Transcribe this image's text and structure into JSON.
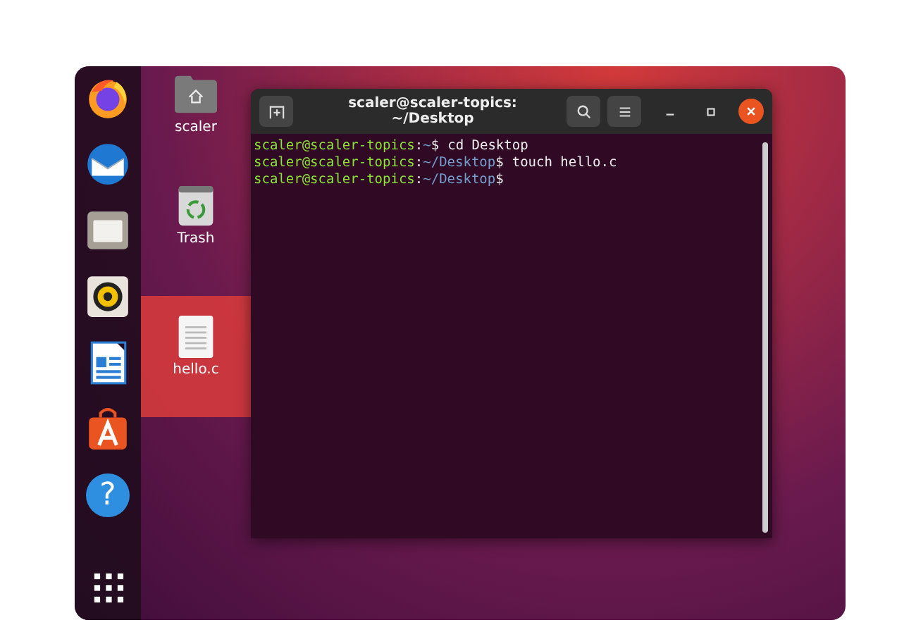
{
  "dock": {
    "items": [
      {
        "kind": "browser"
      },
      {
        "kind": "mail"
      },
      {
        "kind": "files"
      },
      {
        "kind": "speaker"
      },
      {
        "kind": "document"
      },
      {
        "kind": "store"
      },
      {
        "kind": "help",
        "glyph": "?"
      }
    ],
    "apps_button": {
      "kind": "grid"
    }
  },
  "desktop_icons": [
    {
      "kind": "home",
      "label": "scaler",
      "selected": false
    },
    {
      "kind": "trash",
      "label": "Trash",
      "selected": false
    },
    {
      "kind": "file",
      "label": "hello.c",
      "selected": true
    }
  ],
  "terminal": {
    "title": "scaler@scaler-topics: ~/Desktop",
    "lines": [
      {
        "user": "scaler@scaler-topics",
        "sep": ":",
        "path": "~",
        "prompt": "$",
        "command": "cd Desktop"
      },
      {
        "user": "scaler@scaler-topics",
        "sep": ":",
        "path": "~/Desktop",
        "prompt": "$",
        "command": "touch hello.c"
      },
      {
        "user": "scaler@scaler-topics",
        "sep": ":",
        "path": "~/Desktop",
        "prompt": "$"
      }
    ]
  }
}
